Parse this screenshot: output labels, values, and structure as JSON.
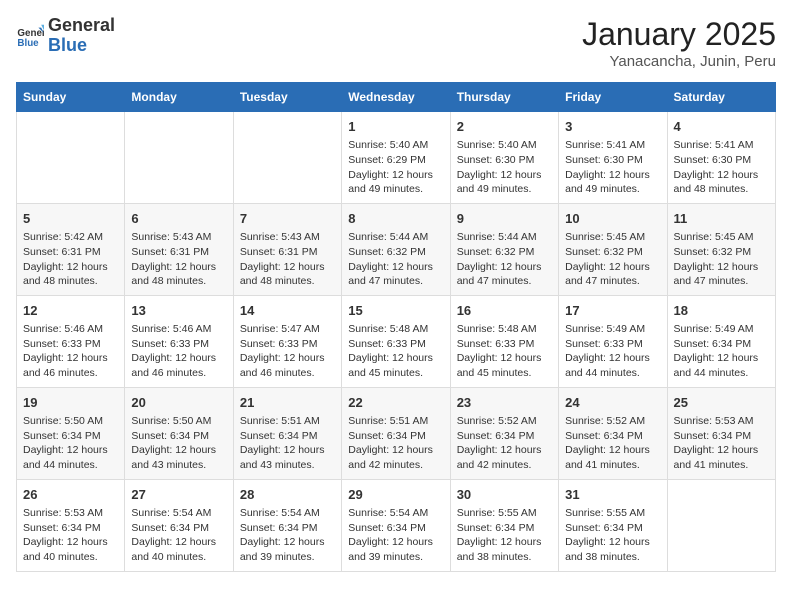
{
  "header": {
    "logo_general": "General",
    "logo_blue": "Blue",
    "title": "January 2025",
    "subtitle": "Yanacancha, Junin, Peru"
  },
  "days_of_week": [
    "Sunday",
    "Monday",
    "Tuesday",
    "Wednesday",
    "Thursday",
    "Friday",
    "Saturday"
  ],
  "weeks": [
    [
      {
        "day": "",
        "info": ""
      },
      {
        "day": "",
        "info": ""
      },
      {
        "day": "",
        "info": ""
      },
      {
        "day": "1",
        "info": "Sunrise: 5:40 AM\nSunset: 6:29 PM\nDaylight: 12 hours and 49 minutes."
      },
      {
        "day": "2",
        "info": "Sunrise: 5:40 AM\nSunset: 6:30 PM\nDaylight: 12 hours and 49 minutes."
      },
      {
        "day": "3",
        "info": "Sunrise: 5:41 AM\nSunset: 6:30 PM\nDaylight: 12 hours and 49 minutes."
      },
      {
        "day": "4",
        "info": "Sunrise: 5:41 AM\nSunset: 6:30 PM\nDaylight: 12 hours and 48 minutes."
      }
    ],
    [
      {
        "day": "5",
        "info": "Sunrise: 5:42 AM\nSunset: 6:31 PM\nDaylight: 12 hours and 48 minutes."
      },
      {
        "day": "6",
        "info": "Sunrise: 5:43 AM\nSunset: 6:31 PM\nDaylight: 12 hours and 48 minutes."
      },
      {
        "day": "7",
        "info": "Sunrise: 5:43 AM\nSunset: 6:31 PM\nDaylight: 12 hours and 48 minutes."
      },
      {
        "day": "8",
        "info": "Sunrise: 5:44 AM\nSunset: 6:32 PM\nDaylight: 12 hours and 47 minutes."
      },
      {
        "day": "9",
        "info": "Sunrise: 5:44 AM\nSunset: 6:32 PM\nDaylight: 12 hours and 47 minutes."
      },
      {
        "day": "10",
        "info": "Sunrise: 5:45 AM\nSunset: 6:32 PM\nDaylight: 12 hours and 47 minutes."
      },
      {
        "day": "11",
        "info": "Sunrise: 5:45 AM\nSunset: 6:32 PM\nDaylight: 12 hours and 47 minutes."
      }
    ],
    [
      {
        "day": "12",
        "info": "Sunrise: 5:46 AM\nSunset: 6:33 PM\nDaylight: 12 hours and 46 minutes."
      },
      {
        "day": "13",
        "info": "Sunrise: 5:46 AM\nSunset: 6:33 PM\nDaylight: 12 hours and 46 minutes."
      },
      {
        "day": "14",
        "info": "Sunrise: 5:47 AM\nSunset: 6:33 PM\nDaylight: 12 hours and 46 minutes."
      },
      {
        "day": "15",
        "info": "Sunrise: 5:48 AM\nSunset: 6:33 PM\nDaylight: 12 hours and 45 minutes."
      },
      {
        "day": "16",
        "info": "Sunrise: 5:48 AM\nSunset: 6:33 PM\nDaylight: 12 hours and 45 minutes."
      },
      {
        "day": "17",
        "info": "Sunrise: 5:49 AM\nSunset: 6:33 PM\nDaylight: 12 hours and 44 minutes."
      },
      {
        "day": "18",
        "info": "Sunrise: 5:49 AM\nSunset: 6:34 PM\nDaylight: 12 hours and 44 minutes."
      }
    ],
    [
      {
        "day": "19",
        "info": "Sunrise: 5:50 AM\nSunset: 6:34 PM\nDaylight: 12 hours and 44 minutes."
      },
      {
        "day": "20",
        "info": "Sunrise: 5:50 AM\nSunset: 6:34 PM\nDaylight: 12 hours and 43 minutes."
      },
      {
        "day": "21",
        "info": "Sunrise: 5:51 AM\nSunset: 6:34 PM\nDaylight: 12 hours and 43 minutes."
      },
      {
        "day": "22",
        "info": "Sunrise: 5:51 AM\nSunset: 6:34 PM\nDaylight: 12 hours and 42 minutes."
      },
      {
        "day": "23",
        "info": "Sunrise: 5:52 AM\nSunset: 6:34 PM\nDaylight: 12 hours and 42 minutes."
      },
      {
        "day": "24",
        "info": "Sunrise: 5:52 AM\nSunset: 6:34 PM\nDaylight: 12 hours and 41 minutes."
      },
      {
        "day": "25",
        "info": "Sunrise: 5:53 AM\nSunset: 6:34 PM\nDaylight: 12 hours and 41 minutes."
      }
    ],
    [
      {
        "day": "26",
        "info": "Sunrise: 5:53 AM\nSunset: 6:34 PM\nDaylight: 12 hours and 40 minutes."
      },
      {
        "day": "27",
        "info": "Sunrise: 5:54 AM\nSunset: 6:34 PM\nDaylight: 12 hours and 40 minutes."
      },
      {
        "day": "28",
        "info": "Sunrise: 5:54 AM\nSunset: 6:34 PM\nDaylight: 12 hours and 39 minutes."
      },
      {
        "day": "29",
        "info": "Sunrise: 5:54 AM\nSunset: 6:34 PM\nDaylight: 12 hours and 39 minutes."
      },
      {
        "day": "30",
        "info": "Sunrise: 5:55 AM\nSunset: 6:34 PM\nDaylight: 12 hours and 38 minutes."
      },
      {
        "day": "31",
        "info": "Sunrise: 5:55 AM\nSunset: 6:34 PM\nDaylight: 12 hours and 38 minutes."
      },
      {
        "day": "",
        "info": ""
      }
    ]
  ]
}
